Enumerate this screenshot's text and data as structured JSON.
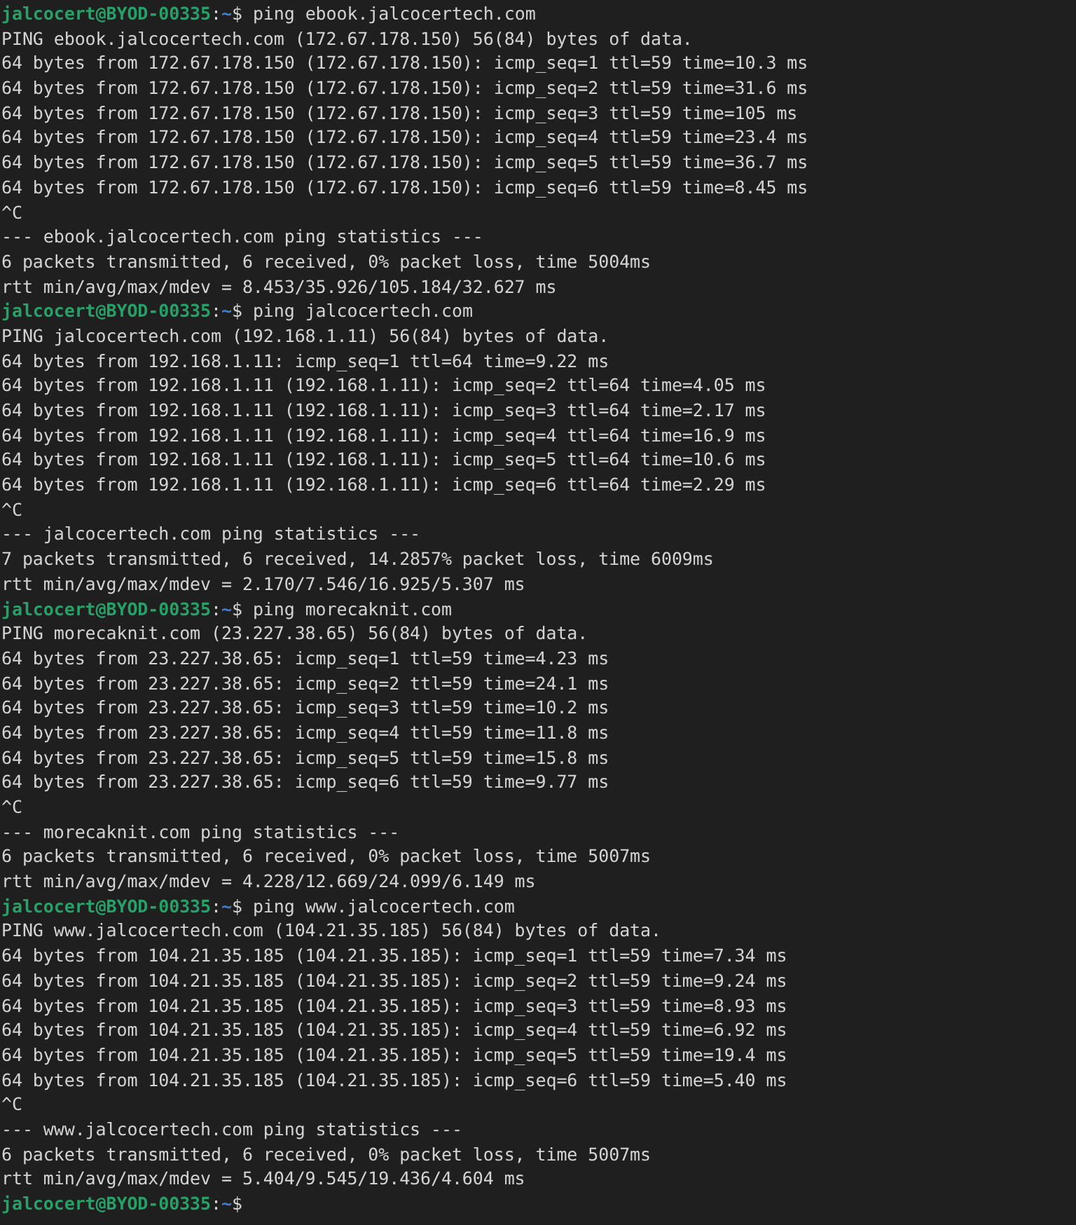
{
  "terminal": {
    "lines": [
      {
        "kind": "prompt",
        "user": "jalcocert@BYOD-00335",
        "separator": ":",
        "path": "~",
        "symbol": "$",
        "command": "ping ebook.jalcocertech.com"
      },
      {
        "kind": "output",
        "text": "PING ebook.jalcocertech.com (172.67.178.150) 56(84) bytes of data."
      },
      {
        "kind": "output",
        "text": "64 bytes from 172.67.178.150 (172.67.178.150): icmp_seq=1 ttl=59 time=10.3 ms"
      },
      {
        "kind": "output",
        "text": "64 bytes from 172.67.178.150 (172.67.178.150): icmp_seq=2 ttl=59 time=31.6 ms"
      },
      {
        "kind": "output",
        "text": "64 bytes from 172.67.178.150 (172.67.178.150): icmp_seq=3 ttl=59 time=105 ms"
      },
      {
        "kind": "output",
        "text": "64 bytes from 172.67.178.150 (172.67.178.150): icmp_seq=4 ttl=59 time=23.4 ms"
      },
      {
        "kind": "output",
        "text": "64 bytes from 172.67.178.150 (172.67.178.150): icmp_seq=5 ttl=59 time=36.7 ms"
      },
      {
        "kind": "output",
        "text": "64 bytes from 172.67.178.150 (172.67.178.150): icmp_seq=6 ttl=59 time=8.45 ms"
      },
      {
        "kind": "output",
        "text": "^C"
      },
      {
        "kind": "output",
        "text": "--- ebook.jalcocertech.com ping statistics ---"
      },
      {
        "kind": "output",
        "text": "6 packets transmitted, 6 received, 0% packet loss, time 5004ms"
      },
      {
        "kind": "output",
        "text": "rtt min/avg/max/mdev = 8.453/35.926/105.184/32.627 ms"
      },
      {
        "kind": "prompt",
        "user": "jalcocert@BYOD-00335",
        "separator": ":",
        "path": "~",
        "symbol": "$",
        "command": "ping jalcocertech.com"
      },
      {
        "kind": "output",
        "text": "PING jalcocertech.com (192.168.1.11) 56(84) bytes of data."
      },
      {
        "kind": "output",
        "text": "64 bytes from 192.168.1.11: icmp_seq=1 ttl=64 time=9.22 ms"
      },
      {
        "kind": "output",
        "text": "64 bytes from 192.168.1.11 (192.168.1.11): icmp_seq=2 ttl=64 time=4.05 ms"
      },
      {
        "kind": "output",
        "text": "64 bytes from 192.168.1.11 (192.168.1.11): icmp_seq=3 ttl=64 time=2.17 ms"
      },
      {
        "kind": "output",
        "text": "64 bytes from 192.168.1.11 (192.168.1.11): icmp_seq=4 ttl=64 time=16.9 ms"
      },
      {
        "kind": "output",
        "text": "64 bytes from 192.168.1.11 (192.168.1.11): icmp_seq=5 ttl=64 time=10.6 ms"
      },
      {
        "kind": "output",
        "text": "64 bytes from 192.168.1.11 (192.168.1.11): icmp_seq=6 ttl=64 time=2.29 ms"
      },
      {
        "kind": "output",
        "text": "^C"
      },
      {
        "kind": "output",
        "text": "--- jalcocertech.com ping statistics ---"
      },
      {
        "kind": "output",
        "text": "7 packets transmitted, 6 received, 14.2857% packet loss, time 6009ms"
      },
      {
        "kind": "output",
        "text": "rtt min/avg/max/mdev = 2.170/7.546/16.925/5.307 ms"
      },
      {
        "kind": "prompt",
        "user": "jalcocert@BYOD-00335",
        "separator": ":",
        "path": "~",
        "symbol": "$",
        "command": "ping morecaknit.com"
      },
      {
        "kind": "output",
        "text": "PING morecaknit.com (23.227.38.65) 56(84) bytes of data."
      },
      {
        "kind": "output",
        "text": "64 bytes from 23.227.38.65: icmp_seq=1 ttl=59 time=4.23 ms"
      },
      {
        "kind": "output",
        "text": "64 bytes from 23.227.38.65: icmp_seq=2 ttl=59 time=24.1 ms"
      },
      {
        "kind": "output",
        "text": "64 bytes from 23.227.38.65: icmp_seq=3 ttl=59 time=10.2 ms"
      },
      {
        "kind": "output",
        "text": "64 bytes from 23.227.38.65: icmp_seq=4 ttl=59 time=11.8 ms"
      },
      {
        "kind": "output",
        "text": "64 bytes from 23.227.38.65: icmp_seq=5 ttl=59 time=15.8 ms"
      },
      {
        "kind": "output",
        "text": "64 bytes from 23.227.38.65: icmp_seq=6 ttl=59 time=9.77 ms"
      },
      {
        "kind": "output",
        "text": "^C"
      },
      {
        "kind": "output",
        "text": "--- morecaknit.com ping statistics ---"
      },
      {
        "kind": "output",
        "text": "6 packets transmitted, 6 received, 0% packet loss, time 5007ms"
      },
      {
        "kind": "output",
        "text": "rtt min/avg/max/mdev = 4.228/12.669/24.099/6.149 ms"
      },
      {
        "kind": "prompt",
        "user": "jalcocert@BYOD-00335",
        "separator": ":",
        "path": "~",
        "symbol": "$",
        "command": "ping www.jalcocertech.com"
      },
      {
        "kind": "output",
        "text": "PING www.jalcocertech.com (104.21.35.185) 56(84) bytes of data."
      },
      {
        "kind": "output",
        "text": "64 bytes from 104.21.35.185 (104.21.35.185): icmp_seq=1 ttl=59 time=7.34 ms"
      },
      {
        "kind": "output",
        "text": "64 bytes from 104.21.35.185 (104.21.35.185): icmp_seq=2 ttl=59 time=9.24 ms"
      },
      {
        "kind": "output",
        "text": "64 bytes from 104.21.35.185 (104.21.35.185): icmp_seq=3 ttl=59 time=8.93 ms"
      },
      {
        "kind": "output",
        "text": "64 bytes from 104.21.35.185 (104.21.35.185): icmp_seq=4 ttl=59 time=6.92 ms"
      },
      {
        "kind": "output",
        "text": "64 bytes from 104.21.35.185 (104.21.35.185): icmp_seq=5 ttl=59 time=19.4 ms"
      },
      {
        "kind": "output",
        "text": "64 bytes from 104.21.35.185 (104.21.35.185): icmp_seq=6 ttl=59 time=5.40 ms"
      },
      {
        "kind": "output",
        "text": "^C"
      },
      {
        "kind": "output",
        "text": "--- www.jalcocertech.com ping statistics ---"
      },
      {
        "kind": "output",
        "text": "6 packets transmitted, 6 received, 0% packet loss, time 5007ms"
      },
      {
        "kind": "output",
        "text": "rtt min/avg/max/mdev = 5.404/9.545/19.436/4.604 ms"
      },
      {
        "kind": "prompt",
        "user": "jalcocert@BYOD-00335",
        "separator": ":",
        "path": "~",
        "symbol": "$"
      }
    ]
  }
}
